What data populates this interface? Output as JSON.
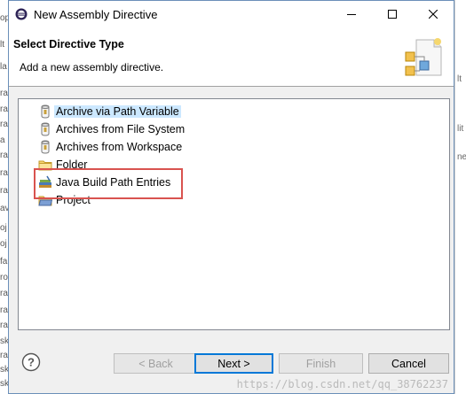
{
  "window": {
    "title": "New Assembly Directive"
  },
  "header": {
    "title": "Select Directive Type",
    "description": "Add a new assembly directive."
  },
  "list": {
    "items": [
      {
        "label": "Archive via Path Variable",
        "icon": "archive-icon",
        "selected": true
      },
      {
        "label": "Archives from File System",
        "icon": "archive-icon"
      },
      {
        "label": "Archives from Workspace",
        "icon": "archive-icon"
      },
      {
        "label": "Folder",
        "icon": "folder-icon"
      },
      {
        "label": "Java Build Path Entries",
        "icon": "java-library-icon",
        "highlighted": true
      },
      {
        "label": "Project",
        "icon": "project-icon"
      }
    ]
  },
  "buttons": {
    "back": "< Back",
    "next": "Next >",
    "finish": "Finish",
    "cancel": "Cancel"
  },
  "watermark": "https://blog.csdn.net/qq_38762237",
  "background": {
    "left_fragments": [
      "op",
      "lt",
      "la",
      "ra",
      "ra",
      "ra",
      "a",
      "ra",
      "ra",
      "ra",
      "av",
      "oj",
      "oj",
      "fa",
      "ro",
      "ra",
      "ra",
      "ra",
      "sk",
      "ra",
      "sk",
      "sk"
    ],
    "right_fragments": [
      "lt",
      "lit",
      "ne"
    ]
  },
  "colors": {
    "highlight_box": "#d9534f",
    "selection": "#cce8ff",
    "default_button_border": "#0078d7"
  }
}
